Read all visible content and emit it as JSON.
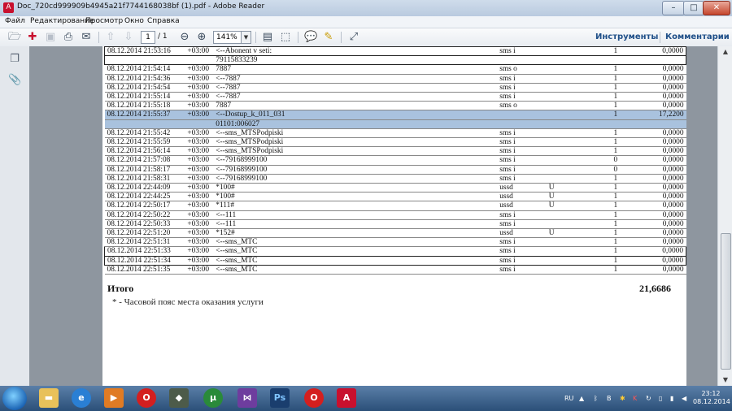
{
  "window": {
    "title": "Doc_720cd999909b4945a21f7744168038bf (1).pdf - Adobe Reader",
    "minimize_glyph": "–",
    "maximize_glyph": "□",
    "close_glyph": "✕"
  },
  "menu": [
    "Файл",
    "Редактирование",
    "Просмотр",
    "Окно",
    "Справка"
  ],
  "toolbar": {
    "page_current": "1",
    "page_total": "/ 1",
    "zoom": "141%",
    "tools_label": "Инструменты",
    "comments_label": "Комментарии"
  },
  "table": {
    "rows": [
      {
        "date": "08.12.2014 21:53:16",
        "tz": "+03:00",
        "number": "<--Abonent v seti:",
        "type": "sms i",
        "flag": "",
        "qty": "1",
        "sum": "0,0000",
        "boxed": true
      },
      {
        "date": "",
        "tz": "",
        "number": "79115833239",
        "type": "",
        "flag": "",
        "qty": "",
        "sum": "",
        "boxed": true
      },
      {
        "date": "08.12.2014 21:54:14",
        "tz": "+03:00",
        "number": "7887",
        "type": "sms o",
        "flag": "",
        "qty": "1",
        "sum": "0,0000"
      },
      {
        "date": "08.12.2014 21:54:36",
        "tz": "+03:00",
        "number": "<--7887",
        "type": "sms i",
        "flag": "",
        "qty": "1",
        "sum": "0,0000"
      },
      {
        "date": "08.12.2014 21:54:54",
        "tz": "+03:00",
        "number": "<--7887",
        "type": "sms i",
        "flag": "",
        "qty": "1",
        "sum": "0,0000"
      },
      {
        "date": "08.12.2014 21:55:14",
        "tz": "+03:00",
        "number": "<--7887",
        "type": "sms i",
        "flag": "",
        "qty": "1",
        "sum": "0,0000"
      },
      {
        "date": "08.12.2014 21:55:18",
        "tz": "+03:00",
        "number": "7887",
        "type": "sms o",
        "flag": "",
        "qty": "1",
        "sum": "0,0000"
      },
      {
        "date": "08.12.2014 21:55:37",
        "tz": "+03:00",
        "number": "<--Dostup_k_011_031",
        "type": "",
        "flag": "",
        "qty": "1",
        "sum": "17,2200",
        "selected": true
      },
      {
        "date": "",
        "tz": "",
        "number": "01101:006027",
        "type": "",
        "flag": "",
        "qty": "",
        "sum": "",
        "selected": true
      },
      {
        "date": "08.12.2014 21:55:42",
        "tz": "+03:00",
        "number": "<--sms_MTSPodpiski",
        "type": "sms i",
        "flag": "",
        "qty": "1",
        "sum": "0,0000"
      },
      {
        "date": "08.12.2014 21:55:59",
        "tz": "+03:00",
        "number": "<--sms_MTSPodpiski",
        "type": "sms i",
        "flag": "",
        "qty": "1",
        "sum": "0,0000"
      },
      {
        "date": "08.12.2014 21:56:14",
        "tz": "+03:00",
        "number": "<--sms_MTSPodpiski",
        "type": "sms i",
        "flag": "",
        "qty": "1",
        "sum": "0,0000"
      },
      {
        "date": "08.12.2014 21:57:08",
        "tz": "+03:00",
        "number": "<--79168999100",
        "type": "sms i",
        "flag": "",
        "qty": "0",
        "sum": "0,0000"
      },
      {
        "date": "08.12.2014 21:58:17",
        "tz": "+03:00",
        "number": "<--79168999100",
        "type": "sms i",
        "flag": "",
        "qty": "0",
        "sum": "0,0000"
      },
      {
        "date": "08.12.2014 21:58:31",
        "tz": "+03:00",
        "number": "<--79168999100",
        "type": "sms i",
        "flag": "",
        "qty": "1",
        "sum": "0,0000"
      },
      {
        "date": "08.12.2014 22:44:09",
        "tz": "+03:00",
        "number": "*100#",
        "type": "ussd",
        "flag": "U",
        "qty": "1",
        "sum": "0,0000"
      },
      {
        "date": "08.12.2014 22:44:25",
        "tz": "+03:00",
        "number": "*100#",
        "type": "ussd",
        "flag": "U",
        "qty": "1",
        "sum": "0,0000"
      },
      {
        "date": "08.12.2014 22:50:17",
        "tz": "+03:00",
        "number": "*111#",
        "type": "ussd",
        "flag": "U",
        "qty": "1",
        "sum": "0,0000"
      },
      {
        "date": "08.12.2014 22:50:22",
        "tz": "+03:00",
        "number": "<--111",
        "type": "sms i",
        "flag": "",
        "qty": "1",
        "sum": "0,0000"
      },
      {
        "date": "08.12.2014 22:50:33",
        "tz": "+03:00",
        "number": "<--111",
        "type": "sms i",
        "flag": "",
        "qty": "1",
        "sum": "0,0000"
      },
      {
        "date": "08.12.2014 22:51:20",
        "tz": "+03:00",
        "number": "*152#",
        "type": "ussd",
        "flag": "U",
        "qty": "1",
        "sum": "0,0000"
      },
      {
        "date": "08.12.2014 22:51:31",
        "tz": "+03:00",
        "number": "<--sms_MTC",
        "type": "sms i",
        "flag": "",
        "qty": "1",
        "sum": "0,0000"
      },
      {
        "date": "08.12.2014 22:51:33",
        "tz": "+03:00",
        "number": "<--sms_MTC",
        "type": "sms i",
        "flag": "",
        "qty": "1",
        "sum": "0,0000",
        "boxed": true
      },
      {
        "date": "08.12.2014 22:51:34",
        "tz": "+03:00",
        "number": "<--sms_MTC",
        "type": "sms i",
        "flag": "",
        "qty": "1",
        "sum": "0,0000",
        "boxed": true
      },
      {
        "date": "08.12.2014 22:51:35",
        "tz": "+03:00",
        "number": "<--sms_MTC",
        "type": "sms i",
        "flag": "",
        "qty": "1",
        "sum": "0,0000"
      }
    ]
  },
  "summary": {
    "total_label": "Итого",
    "total_value": "21,6686",
    "footnote": "* - Часовой пояс места оказания услуги"
  },
  "taskbar": {
    "lang": "RU",
    "time": "23:12",
    "date": "08.12.2014"
  },
  "colors": {
    "selection": "#a9c2de",
    "link_blue": "#1f4f88",
    "taskbar": "#2b4f78"
  }
}
